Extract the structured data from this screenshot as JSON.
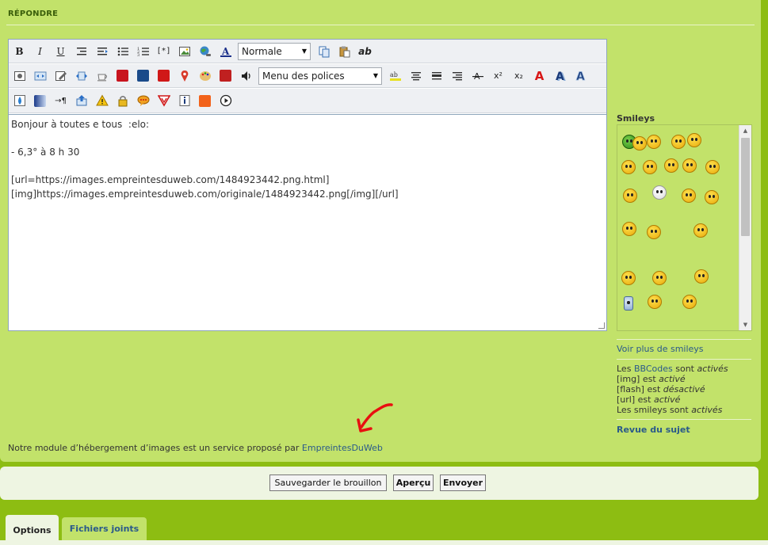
{
  "section": {
    "title": "RÉPONDRE"
  },
  "toolbar": {
    "row1": {
      "bold": "B",
      "italic": "I",
      "underline": "U",
      "spoiler_tag": "[*]",
      "size_select": "Normale",
      "clear_format": "ab"
    },
    "row2": {
      "font_select": "Menu des polices",
      "superscript": "x²",
      "subscript": "x₂",
      "text_effect": "A"
    }
  },
  "editor": {
    "lines": [
      "Bonjour à toutes e tous  :elo:",
      "",
      "- 6,3° à 8 h 30",
      "",
      "[url=https://images.empreintesduweb.com/1484923442.png.html]",
      "[img]https://images.empreintesduweb.com/originale/1484923442.png[/img][/url]"
    ]
  },
  "smileys": {
    "title": "Smileys",
    "more_link": "Voir plus de smileys"
  },
  "bbcode_info": {
    "les": "Les",
    "bbcodes_link": "BBCodes",
    "sont": "sont",
    "actives": "activés",
    "img_label": "[img] est",
    "img_status": "activé",
    "flash_label": "[flash] est",
    "flash_status": "désactivé",
    "url_label": "[url] est",
    "url_status": "activé",
    "smileys_label": "Les smileys sont",
    "smileys_status": "activés"
  },
  "review_link": "Revue du sujet",
  "module_note": {
    "text": "Notre module d’hébergement d’images est un service proposé par",
    "link": "EmpreintesDuWeb"
  },
  "actions": {
    "save_draft": "Sauvegarder le brouillon",
    "preview": "Aperçu",
    "send": "Envoyer"
  },
  "tabs": [
    {
      "label": "Options",
      "active": true
    },
    {
      "label": "Fichiers joints",
      "active": false
    }
  ],
  "colors": {
    "page_bg": "#8dbd12",
    "panel_bg": "#c2e26a",
    "link": "#2a5a8a",
    "annotation_arrow": "#e81010"
  }
}
